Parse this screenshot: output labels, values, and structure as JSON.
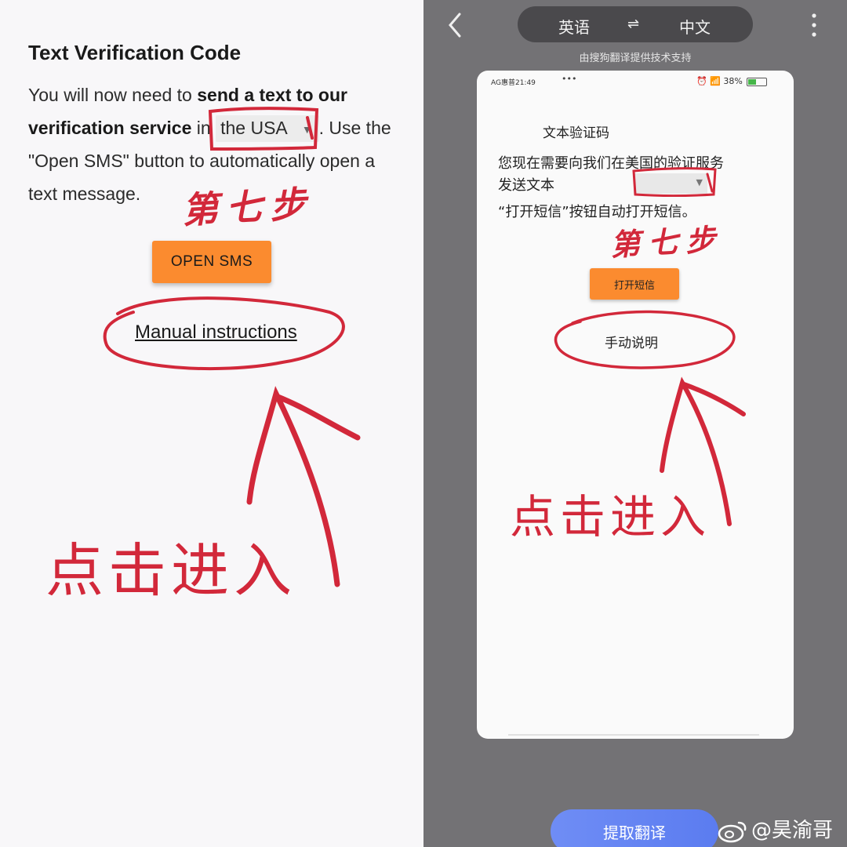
{
  "left": {
    "title": "Text Verification Code",
    "para": {
      "t1": "You will now need to ",
      "b1": "send a text to our verification service",
      "t2": " in ",
      "country": "the USA",
      "t3": ". Use the \"Open SMS\" button to automatically open a text message."
    },
    "open_sms_label": "OPEN SMS",
    "manual_link": "Manual instructions",
    "handwritten_step": "第七步",
    "handwritten_click": "点击进入"
  },
  "right": {
    "lang_source": "英语",
    "lang_swap": "⇌",
    "lang_target": "中文",
    "powered_by": "由搜狗翻译提供技术支持",
    "status": {
      "carrier_time": "AG惠普21:49",
      "dots": "•••",
      "battery_pct": "38%"
    },
    "translated": {
      "title": "文本验证码",
      "line1": "您现在需要向我们在美国的验证服务",
      "line2": "发送文本",
      "dot": ".",
      "line3": "“打开短信”按钮自动打开短信。",
      "open_sms": "打开短信",
      "manual": "手动说明"
    },
    "handwritten_step": "第七步",
    "handwritten_click": "点击进入",
    "extract_button": "提取翻译",
    "watermark": "@昊渝哥"
  },
  "colors": {
    "accent_orange": "#fb8b2f",
    "annotation_red": "#d2283a",
    "extract_blue": "#5b7cf0",
    "right_bg": "#737275"
  }
}
